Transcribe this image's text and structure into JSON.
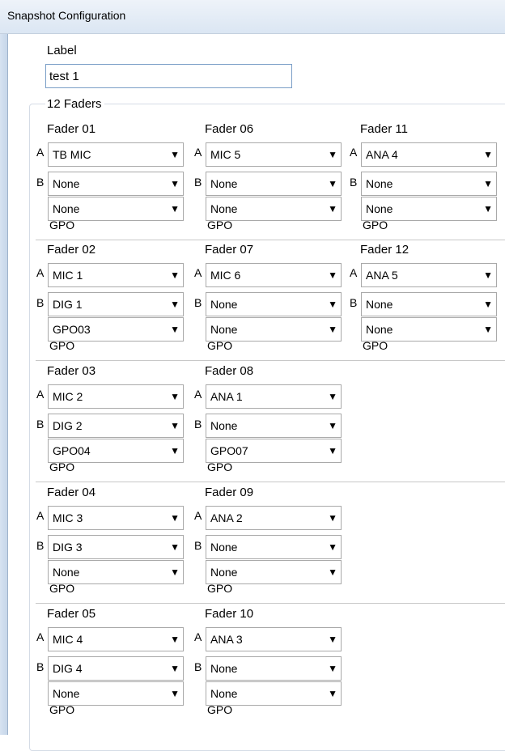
{
  "window": {
    "title": "Snapshot Configuration"
  },
  "label": {
    "heading": "Label",
    "value": "test 1"
  },
  "group": {
    "title": "12 Faders"
  },
  "letters": {
    "a": "A",
    "b": "B"
  },
  "gpo_label": "GPO",
  "dropdown_icon": "chevron-down-icon",
  "faders": [
    {
      "name": "Fader 01",
      "a": "TB MIC",
      "b": "None",
      "gpo": "None"
    },
    {
      "name": "Fader 02",
      "a": "MIC 1",
      "b": "DIG 1",
      "gpo": "GPO03"
    },
    {
      "name": "Fader 03",
      "a": "MIC 2",
      "b": "DIG 2",
      "gpo": "GPO04"
    },
    {
      "name": "Fader 04",
      "a": "MIC 3",
      "b": "DIG 3",
      "gpo": "None"
    },
    {
      "name": "Fader 05",
      "a": "MIC 4",
      "b": "DIG 4",
      "gpo": "None"
    },
    {
      "name": "Fader 06",
      "a": "MIC 5",
      "b": "None",
      "gpo": "None"
    },
    {
      "name": "Fader 07",
      "a": "MIC 6",
      "b": "None",
      "gpo": "None"
    },
    {
      "name": "Fader 08",
      "a": "ANA 1",
      "b": "None",
      "gpo": "GPO07"
    },
    {
      "name": "Fader 09",
      "a": "ANA 2",
      "b": "None",
      "gpo": "None"
    },
    {
      "name": "Fader 10",
      "a": "ANA 3",
      "b": "None",
      "gpo": "None"
    },
    {
      "name": "Fader 11",
      "a": "ANA 4",
      "b": "None",
      "gpo": "None"
    },
    {
      "name": "Fader 12",
      "a": "ANA 5",
      "b": "None",
      "gpo": "None"
    }
  ]
}
